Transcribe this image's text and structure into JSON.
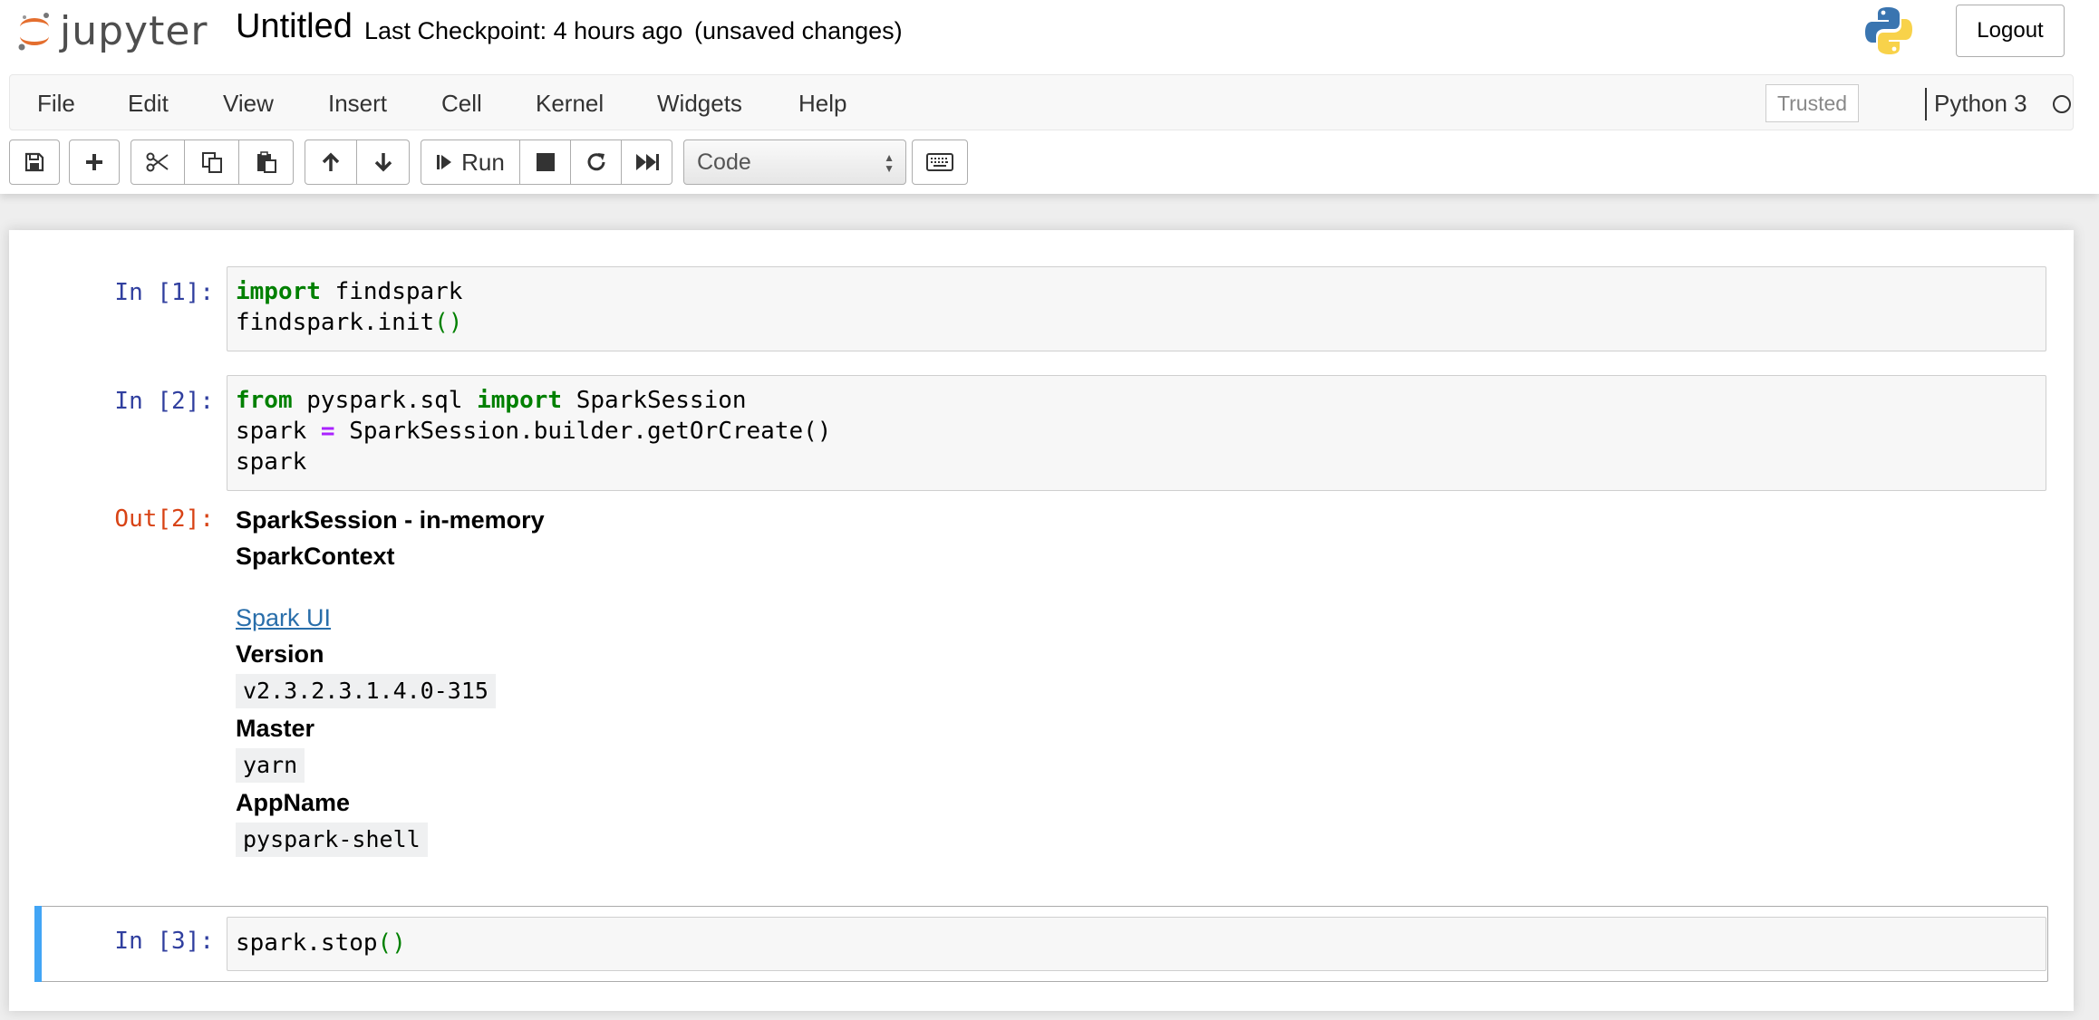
{
  "header": {
    "logo_text": "jupyter",
    "notebook_title": "Untitled",
    "checkpoint": "Last Checkpoint: 4 hours ago",
    "status": "(unsaved changes)",
    "logout_label": "Logout"
  },
  "menubar": {
    "items": [
      "File",
      "Edit",
      "View",
      "Insert",
      "Cell",
      "Kernel",
      "Widgets",
      "Help"
    ],
    "trusted_label": "Trusted",
    "kernel_name": "Python 3"
  },
  "toolbar": {
    "run_label": "Run",
    "cell_type": "Code"
  },
  "cells": [
    {
      "prompt": "In [1]:",
      "lines": [
        [
          {
            "t": "import",
            "c": "kw"
          },
          {
            "t": " findspark",
            "c": ""
          }
        ],
        [
          {
            "t": "findspark.init",
            "c": ""
          },
          {
            "t": "()",
            "c": "paren"
          }
        ]
      ]
    },
    {
      "prompt": "In [2]:",
      "lines": [
        [
          {
            "t": "from",
            "c": "kw"
          },
          {
            "t": " pyspark.sql ",
            "c": ""
          },
          {
            "t": "import",
            "c": "kw"
          },
          {
            "t": " SparkSession",
            "c": ""
          }
        ],
        [
          {
            "t": "spark ",
            "c": ""
          },
          {
            "t": "=",
            "c": "op"
          },
          {
            "t": " SparkSession.builder.getOrCreate()",
            "c": ""
          }
        ],
        [
          {
            "t": "spark",
            "c": ""
          }
        ]
      ]
    },
    {
      "prompt": "In [3]:",
      "lines": [
        [
          {
            "t": "spark.stop",
            "c": ""
          },
          {
            "t": "()",
            "c": "paren"
          }
        ]
      ]
    }
  ],
  "output": {
    "prompt": "Out[2]:",
    "session_title": "SparkSession - in-memory",
    "context_title": "SparkContext",
    "spark_ui_link": "Spark UI",
    "version_label": "Version",
    "version_value": "v2.3.2.3.1.4.0-315",
    "master_label": "Master",
    "master_value": "yarn",
    "appname_label": "AppName",
    "appname_value": "pyspark-shell"
  },
  "colors": {
    "prompt_in": "#303f9f",
    "prompt_out": "#d84315",
    "selected_cell_bar": "#42a5f5",
    "keyword": "#008000",
    "operator": "#aa22ff",
    "link": "#296eaa"
  }
}
